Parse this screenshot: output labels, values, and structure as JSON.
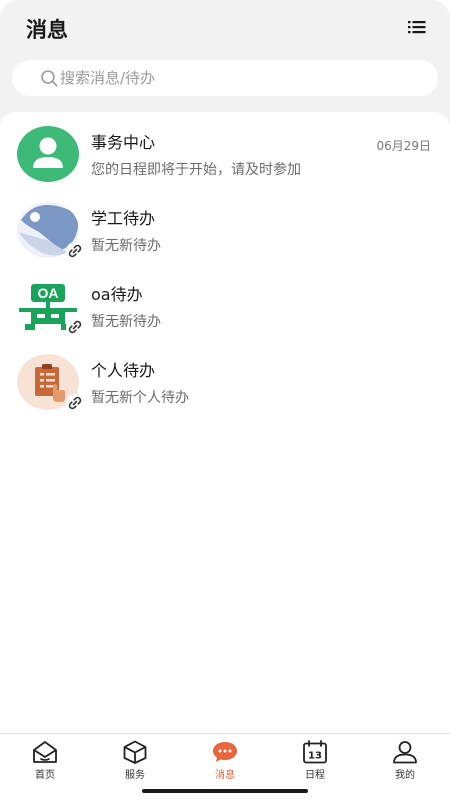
{
  "header": {
    "title": "消息",
    "menu_icon": "list-menu-icon"
  },
  "search": {
    "placeholder": "搜索消息/待办",
    "icon": "search-icon"
  },
  "messages": [
    {
      "title": "事务中心",
      "subtitle": "您的日程即将于开始，请及时参加",
      "date": "06月29日",
      "icon": "person-avatar-icon",
      "avatar_color": "#3dba78"
    },
    {
      "title": "学工待办",
      "subtitle": "暂无新待办",
      "icon": "student-affairs-logo-icon",
      "avatar_color": "#7b97c4"
    },
    {
      "title": "oa待办",
      "subtitle": "暂无新待办",
      "icon": "oa-logo-icon",
      "logo_text": "OA",
      "avatar_color": "#1aa35a"
    },
    {
      "title": "个人待办",
      "subtitle": "暂无新个人待办",
      "icon": "clipboard-icon",
      "avatar_color": "#c8693a"
    }
  ],
  "tabbar": {
    "active_color": "#e8663d",
    "tabs": [
      {
        "label": "首页",
        "icon": "home-icon"
      },
      {
        "label": "服务",
        "icon": "cube-icon"
      },
      {
        "label": "消息",
        "icon": "chat-bubble-icon",
        "active": true
      },
      {
        "label": "日程",
        "icon": "calendar-icon",
        "day": "13"
      },
      {
        "label": "我的",
        "icon": "user-icon"
      }
    ]
  }
}
